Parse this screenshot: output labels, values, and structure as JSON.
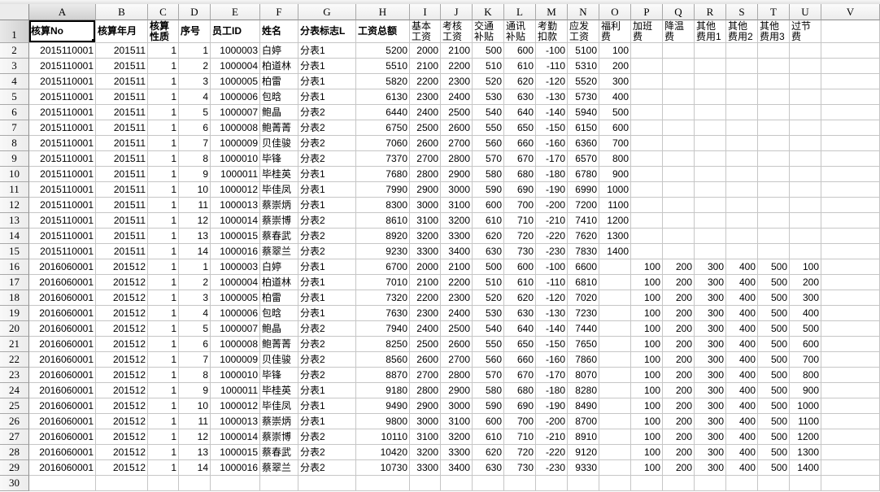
{
  "theme": {
    "gridline": "#c6c6c6",
    "header_background": "#ececec",
    "selection_border": "#000000"
  },
  "sheet": {
    "column_headers": [
      "A",
      "B",
      "C",
      "D",
      "E",
      "F",
      "G",
      "H",
      "I",
      "J",
      "K",
      "L",
      "M",
      "N",
      "O",
      "P",
      "Q",
      "R",
      "S",
      "T",
      "U",
      "V"
    ],
    "row_headers": [
      "1",
      "2",
      "3",
      "4",
      "5",
      "6",
      "7",
      "8",
      "9",
      "10",
      "11",
      "12",
      "13",
      "14",
      "15",
      "16",
      "17",
      "18",
      "19",
      "20",
      "21",
      "22",
      "23",
      "24",
      "25",
      "26",
      "27",
      "28",
      "29",
      "30"
    ],
    "header_row": [
      "核算No",
      "核算年月",
      "核算\n性质",
      "序号",
      "员工ID",
      "姓名",
      "分表标志L",
      "工资总额",
      "基本\n工资",
      "考核\n工资",
      "交通\n补贴",
      "通讯\n补贴",
      "考勤\n扣款",
      "应发\n工资",
      "福利\n费",
      "加班\n费",
      "降温\n费",
      "其他\n费用1",
      "其他\n费用2",
      "其他\n费用3",
      "过节\n费",
      ""
    ],
    "rows": [
      [
        "2015110001",
        "201511",
        "1",
        "1",
        "1000003",
        "白婷",
        "分表1",
        "5200",
        "2000",
        "2100",
        "500",
        "600",
        "-100",
        "5100",
        "100"
      ],
      [
        "2015110001",
        "201511",
        "1",
        "2",
        "1000004",
        "柏道林",
        "分表1",
        "5510",
        "2100",
        "2200",
        "510",
        "610",
        "-110",
        "5310",
        "200"
      ],
      [
        "2015110001",
        "201511",
        "1",
        "3",
        "1000005",
        "柏雷",
        "分表1",
        "5820",
        "2200",
        "2300",
        "520",
        "620",
        "-120",
        "5520",
        "300"
      ],
      [
        "2015110001",
        "201511",
        "1",
        "4",
        "1000006",
        "包晗",
        "分表1",
        "6130",
        "2300",
        "2400",
        "530",
        "630",
        "-130",
        "5730",
        "400"
      ],
      [
        "2015110001",
        "201511",
        "1",
        "5",
        "1000007",
        "鲍晶",
        "分表2",
        "6440",
        "2400",
        "2500",
        "540",
        "640",
        "-140",
        "5940",
        "500"
      ],
      [
        "2015110001",
        "201511",
        "1",
        "6",
        "1000008",
        "鲍菁菁",
        "分表2",
        "6750",
        "2500",
        "2600",
        "550",
        "650",
        "-150",
        "6150",
        "600"
      ],
      [
        "2015110001",
        "201511",
        "1",
        "7",
        "1000009",
        "贝佳骏",
        "分表2",
        "7060",
        "2600",
        "2700",
        "560",
        "660",
        "-160",
        "6360",
        "700"
      ],
      [
        "2015110001",
        "201511",
        "1",
        "8",
        "1000010",
        "毕锋",
        "分表2",
        "7370",
        "2700",
        "2800",
        "570",
        "670",
        "-170",
        "6570",
        "800"
      ],
      [
        "2015110001",
        "201511",
        "1",
        "9",
        "1000011",
        "毕桂英",
        "分表1",
        "7680",
        "2800",
        "2900",
        "580",
        "680",
        "-180",
        "6780",
        "900"
      ],
      [
        "2015110001",
        "201511",
        "1",
        "10",
        "1000012",
        "毕佳凤",
        "分表1",
        "7990",
        "2900",
        "3000",
        "590",
        "690",
        "-190",
        "6990",
        "1000"
      ],
      [
        "2015110001",
        "201511",
        "1",
        "11",
        "1000013",
        "蔡崇炳",
        "分表1",
        "8300",
        "3000",
        "3100",
        "600",
        "700",
        "-200",
        "7200",
        "1100"
      ],
      [
        "2015110001",
        "201511",
        "1",
        "12",
        "1000014",
        "蔡崇博",
        "分表2",
        "8610",
        "3100",
        "3200",
        "610",
        "710",
        "-210",
        "7410",
        "1200"
      ],
      [
        "2015110001",
        "201511",
        "1",
        "13",
        "1000015",
        "蔡春武",
        "分表2",
        "8920",
        "3200",
        "3300",
        "620",
        "720",
        "-220",
        "7620",
        "1300"
      ],
      [
        "2015110001",
        "201511",
        "1",
        "14",
        "1000016",
        "蔡翠兰",
        "分表2",
        "9230",
        "3300",
        "3400",
        "630",
        "730",
        "-230",
        "7830",
        "1400"
      ],
      [
        "2016060001",
        "201512",
        "1",
        "1",
        "1000003",
        "白婷",
        "分表1",
        "6700",
        "2000",
        "2100",
        "500",
        "600",
        "-100",
        "6600",
        "",
        "100",
        "200",
        "300",
        "400",
        "500",
        "100"
      ],
      [
        "2016060001",
        "201512",
        "1",
        "2",
        "1000004",
        "柏道林",
        "分表1",
        "7010",
        "2100",
        "2200",
        "510",
        "610",
        "-110",
        "6810",
        "",
        "100",
        "200",
        "300",
        "400",
        "500",
        "200"
      ],
      [
        "2016060001",
        "201512",
        "1",
        "3",
        "1000005",
        "柏雷",
        "分表1",
        "7320",
        "2200",
        "2300",
        "520",
        "620",
        "-120",
        "7020",
        "",
        "100",
        "200",
        "300",
        "400",
        "500",
        "300"
      ],
      [
        "2016060001",
        "201512",
        "1",
        "4",
        "1000006",
        "包晗",
        "分表1",
        "7630",
        "2300",
        "2400",
        "530",
        "630",
        "-130",
        "7230",
        "",
        "100",
        "200",
        "300",
        "400",
        "500",
        "400"
      ],
      [
        "2016060001",
        "201512",
        "1",
        "5",
        "1000007",
        "鲍晶",
        "分表2",
        "7940",
        "2400",
        "2500",
        "540",
        "640",
        "-140",
        "7440",
        "",
        "100",
        "200",
        "300",
        "400",
        "500",
        "500"
      ],
      [
        "2016060001",
        "201512",
        "1",
        "6",
        "1000008",
        "鲍菁菁",
        "分表2",
        "8250",
        "2500",
        "2600",
        "550",
        "650",
        "-150",
        "7650",
        "",
        "100",
        "200",
        "300",
        "400",
        "500",
        "600"
      ],
      [
        "2016060001",
        "201512",
        "1",
        "7",
        "1000009",
        "贝佳骏",
        "分表2",
        "8560",
        "2600",
        "2700",
        "560",
        "660",
        "-160",
        "7860",
        "",
        "100",
        "200",
        "300",
        "400",
        "500",
        "700"
      ],
      [
        "2016060001",
        "201512",
        "1",
        "8",
        "1000010",
        "毕锋",
        "分表2",
        "8870",
        "2700",
        "2800",
        "570",
        "670",
        "-170",
        "8070",
        "",
        "100",
        "200",
        "300",
        "400",
        "500",
        "800"
      ],
      [
        "2016060001",
        "201512",
        "1",
        "9",
        "1000011",
        "毕桂英",
        "分表1",
        "9180",
        "2800",
        "2900",
        "580",
        "680",
        "-180",
        "8280",
        "",
        "100",
        "200",
        "300",
        "400",
        "500",
        "900"
      ],
      [
        "2016060001",
        "201512",
        "1",
        "10",
        "1000012",
        "毕佳凤",
        "分表1",
        "9490",
        "2900",
        "3000",
        "590",
        "690",
        "-190",
        "8490",
        "",
        "100",
        "200",
        "300",
        "400",
        "500",
        "1000"
      ],
      [
        "2016060001",
        "201512",
        "1",
        "11",
        "1000013",
        "蔡崇炳",
        "分表1",
        "9800",
        "3000",
        "3100",
        "600",
        "700",
        "-200",
        "8700",
        "",
        "100",
        "200",
        "300",
        "400",
        "500",
        "1100"
      ],
      [
        "2016060001",
        "201512",
        "1",
        "12",
        "1000014",
        "蔡崇博",
        "分表2",
        "10110",
        "3100",
        "3200",
        "610",
        "710",
        "-210",
        "8910",
        "",
        "100",
        "200",
        "300",
        "400",
        "500",
        "1200"
      ],
      [
        "2016060001",
        "201512",
        "1",
        "13",
        "1000015",
        "蔡春武",
        "分表2",
        "10420",
        "3200",
        "3300",
        "620",
        "720",
        "-220",
        "9120",
        "",
        "100",
        "200",
        "300",
        "400",
        "500",
        "1300"
      ],
      [
        "2016060001",
        "201512",
        "1",
        "14",
        "1000016",
        "蔡翠兰",
        "分表2",
        "10730",
        "3300",
        "3400",
        "630",
        "730",
        "-230",
        "9330",
        "",
        "100",
        "200",
        "300",
        "400",
        "500",
        "1400"
      ]
    ]
  }
}
